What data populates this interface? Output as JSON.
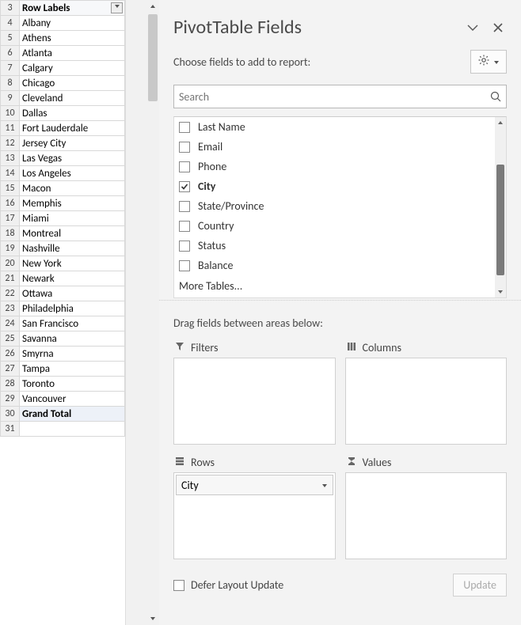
{
  "sheet": {
    "header_label": "Row Labels",
    "rows": [
      {
        "num": 3,
        "label": "Row Labels",
        "type": "header"
      },
      {
        "num": 4,
        "label": "Albany"
      },
      {
        "num": 5,
        "label": "Athens"
      },
      {
        "num": 6,
        "label": "Atlanta"
      },
      {
        "num": 7,
        "label": "Calgary"
      },
      {
        "num": 8,
        "label": "Chicago"
      },
      {
        "num": 9,
        "label": "Cleveland"
      },
      {
        "num": 10,
        "label": "Dallas"
      },
      {
        "num": 11,
        "label": "Fort Lauderdale"
      },
      {
        "num": 12,
        "label": "Jersey City"
      },
      {
        "num": 13,
        "label": "Las Vegas"
      },
      {
        "num": 14,
        "label": "Los Angeles"
      },
      {
        "num": 15,
        "label": "Macon"
      },
      {
        "num": 16,
        "label": "Memphis"
      },
      {
        "num": 17,
        "label": "Miami"
      },
      {
        "num": 18,
        "label": "Montreal"
      },
      {
        "num": 19,
        "label": "Nashville"
      },
      {
        "num": 20,
        "label": "New York"
      },
      {
        "num": 21,
        "label": "Newark"
      },
      {
        "num": 22,
        "label": "Ottawa"
      },
      {
        "num": 23,
        "label": "Philadelphia"
      },
      {
        "num": 24,
        "label": "San Francisco"
      },
      {
        "num": 25,
        "label": "Savanna"
      },
      {
        "num": 26,
        "label": "Smyrna"
      },
      {
        "num": 27,
        "label": "Tampa"
      },
      {
        "num": 28,
        "label": "Toronto"
      },
      {
        "num": 29,
        "label": "Vancouver"
      },
      {
        "num": 30,
        "label": "Grand Total",
        "type": "total"
      },
      {
        "num": 31,
        "label": ""
      }
    ]
  },
  "panel": {
    "title": "PivotTable Fields",
    "subtitle": "Choose fields to add to report:",
    "search_placeholder": "Search",
    "fields": [
      {
        "label": "Last Name",
        "checked": false
      },
      {
        "label": "Email",
        "checked": false
      },
      {
        "label": "Phone",
        "checked": false
      },
      {
        "label": "City",
        "checked": true
      },
      {
        "label": "State/Province",
        "checked": false
      },
      {
        "label": "Country",
        "checked": false
      },
      {
        "label": "Status",
        "checked": false
      },
      {
        "label": "Balance",
        "checked": false
      }
    ],
    "more_tables": "More Tables...",
    "drag_label": "Drag fields between areas below:",
    "areas": {
      "filters": {
        "title": "Filters",
        "items": []
      },
      "columns": {
        "title": "Columns",
        "items": []
      },
      "rows": {
        "title": "Rows",
        "items": [
          "City"
        ]
      },
      "values": {
        "title": "Values",
        "items": []
      }
    },
    "defer_label": "Defer Layout Update",
    "update_label": "Update"
  }
}
